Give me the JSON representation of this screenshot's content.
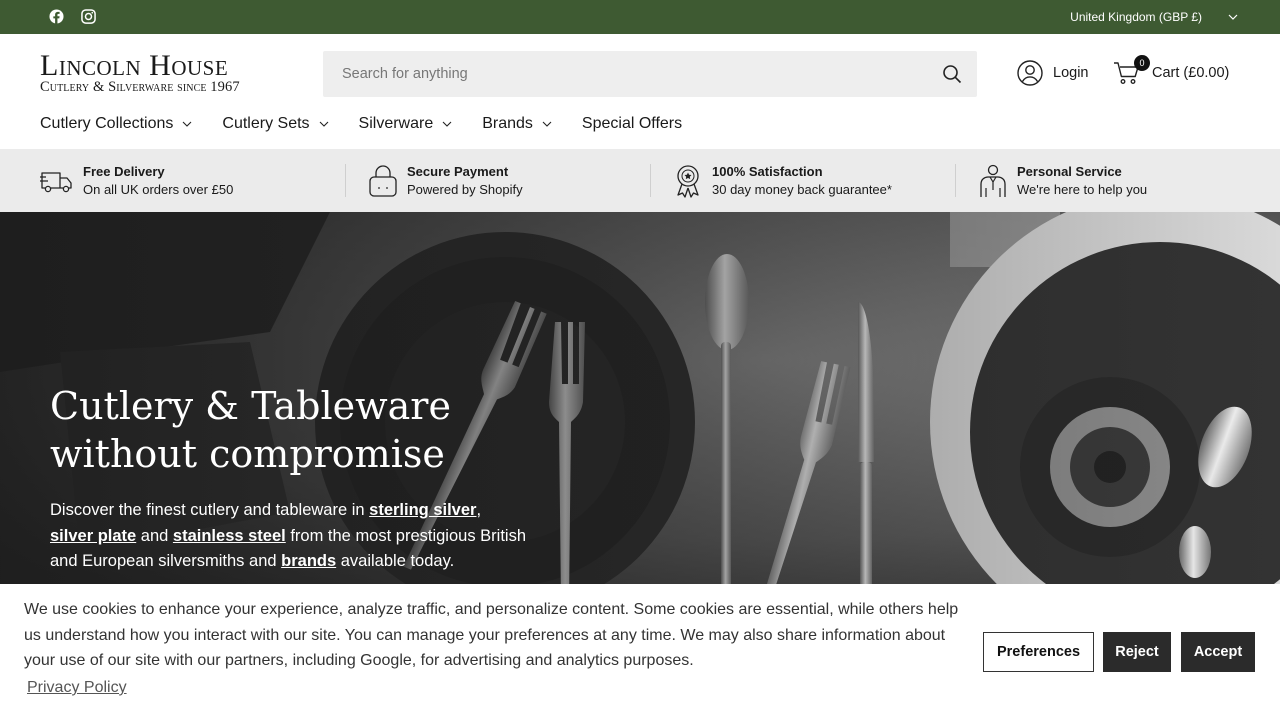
{
  "topbar": {
    "social": [
      "facebook-icon",
      "instagram-icon"
    ],
    "region": "United Kingdom (GBP £)"
  },
  "header": {
    "logo_line1": "Lincoln House",
    "logo_line2": "Cutlery & Silverware since 1967",
    "search_placeholder": "Search for anything",
    "login_label": "Login",
    "cart_label": "Cart (£0.00)",
    "cart_count": "0"
  },
  "nav": {
    "items": [
      {
        "label": "Cutlery Collections",
        "has_dropdown": true
      },
      {
        "label": "Cutlery Sets",
        "has_dropdown": true
      },
      {
        "label": "Silverware",
        "has_dropdown": true
      },
      {
        "label": "Brands",
        "has_dropdown": true
      },
      {
        "label": "Special Offers",
        "has_dropdown": false
      }
    ]
  },
  "benefits": [
    {
      "icon": "delivery-truck-icon",
      "title": "Free Delivery",
      "subtitle": "On all UK orders over £50"
    },
    {
      "icon": "padlock-icon",
      "title": "Secure Payment",
      "subtitle": "Powered by Shopify"
    },
    {
      "icon": "award-rosette-icon",
      "title": "100% Satisfaction",
      "subtitle": "30 day money back guarantee*"
    },
    {
      "icon": "person-service-icon",
      "title": "Personal Service",
      "subtitle": "We're here to help you"
    }
  ],
  "hero": {
    "title_line1": "Cutlery & Tableware",
    "title_line2": "without compromise",
    "desc_part1": "Discover the finest cutlery and tableware in ",
    "link_sterling": "sterling silver",
    "desc_part2": ",",
    "link_silverplate": "silver plate",
    "desc_part3": " and ",
    "link_stainless": "stainless steel",
    "desc_part4": " from the most prestigious British and European silversmiths and ",
    "link_brands": "brands",
    "desc_part5": " available today."
  },
  "cookie": {
    "text": "We use cookies to enhance your experience, analyze traffic, and personalize content. Some cookies are essential, while others help us understand how you interact with our site. You can manage your preferences at any time. We may also share information about your use of our site with our partners, including Google, for advertising and analytics purposes.",
    "privacy": "Privacy Policy",
    "preferences": "Preferences",
    "reject": "Reject",
    "accept": "Accept"
  },
  "colors": {
    "topbar": "#3e5a32",
    "benefits_bg": "#ebebeb",
    "button_dark": "#2b2b2b"
  }
}
